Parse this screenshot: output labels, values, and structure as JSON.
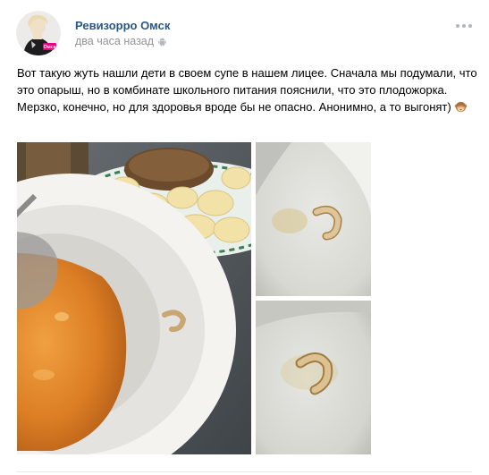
{
  "post": {
    "author": {
      "name": "Ревизорро Омск",
      "avatar_label": "Омск"
    },
    "time": "два часа назад",
    "time_icon": "android-icon",
    "more_icon": "more-icon",
    "text": "Вот такую жуть нашли дети в своем супе в нашем лицее. Сначала мы подумали, что это опарыш, но в комбинате школьного питания пояснили, что это плодожорка. Мерзко, конечно, но для здоровья вроде бы не опасно. Анонимно, а то выгонят)",
    "text_emoji": "see-no-evil-monkey-emoji",
    "photos": [
      {
        "name": "photo-soup-plate",
        "icon": "photo"
      },
      {
        "name": "photo-larva-closeup-1",
        "icon": "photo"
      },
      {
        "name": "photo-larva-closeup-2",
        "icon": "photo"
      }
    ]
  },
  "colors": {
    "author_link": "#2a5885",
    "meta_text": "#939393",
    "divider": "#e7e8ec"
  }
}
